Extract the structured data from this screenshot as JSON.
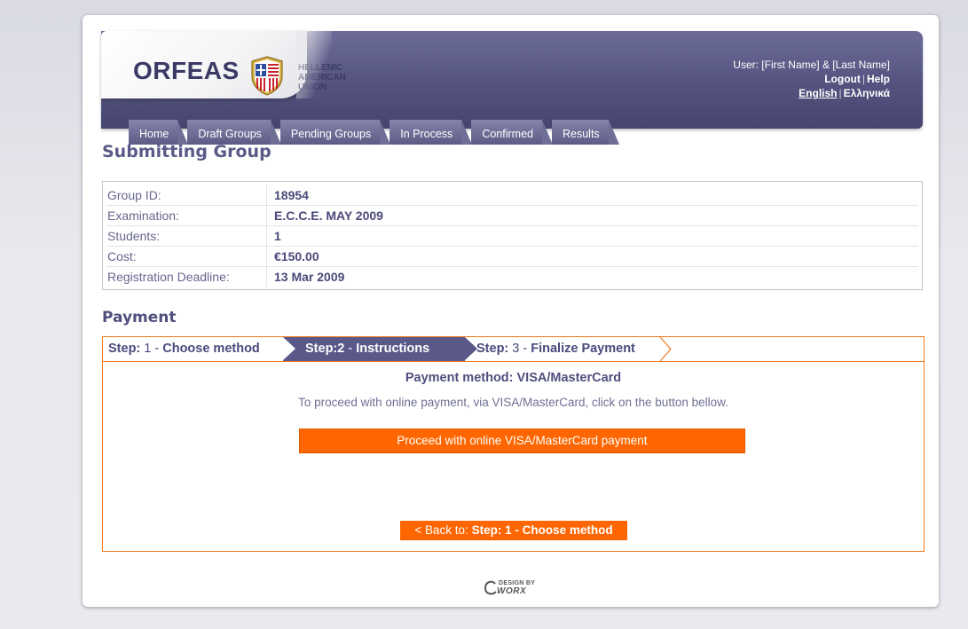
{
  "header": {
    "brand": "ORFEAS",
    "union": [
      "HELLENIC",
      "AMERICAN",
      "UNION"
    ],
    "user_label": "User: [First Name] & [Last Name]",
    "logout": "Logout",
    "help": "Help",
    "lang_english": "English",
    "lang_greek": "Ελληνικά"
  },
  "tabs": [
    {
      "label": "Home"
    },
    {
      "label": "Draft Groups"
    },
    {
      "label": "Pending Groups"
    },
    {
      "label": "In Process"
    },
    {
      "label": "Confirmed"
    },
    {
      "label": "Results"
    }
  ],
  "page_title": "Submitting Group",
  "group_info": [
    {
      "label": "Group ID:",
      "value": "18954"
    },
    {
      "label": "Examination:",
      "value": "E.C.C.E. MAY 2009"
    },
    {
      "label": "Students:",
      "value": "1"
    },
    {
      "label": "Cost:",
      "value": "€150.00"
    },
    {
      "label": "Registration Deadline:",
      "value": "13 Mar 2009"
    }
  ],
  "payment": {
    "title": "Payment",
    "steps": [
      {
        "prefix": "Step:",
        "num": " 1 - ",
        "label": "Choose method"
      },
      {
        "prefix": "Step:2",
        "num": " - ",
        "label": "Instructions"
      },
      {
        "prefix": "Step:",
        "num": " 3 - ",
        "label": "Finalize Payment"
      }
    ],
    "method_title": "Payment method: VISA/MasterCard",
    "method_text": "To proceed with online payment, via VISA/MasterCard, click on the button bellow.",
    "proceed_button": "Proceed with online VISA/MasterCard payment",
    "back_prefix": "< Back to: ",
    "back_target": "Step: 1 - Choose method"
  },
  "footer": {
    "design_by": "DESIGN BY",
    "company": "WORX"
  },
  "colors": {
    "header_purple": "#54537f",
    "accent_orange": "#ff6600",
    "text_purple": "#4f4f7e"
  }
}
